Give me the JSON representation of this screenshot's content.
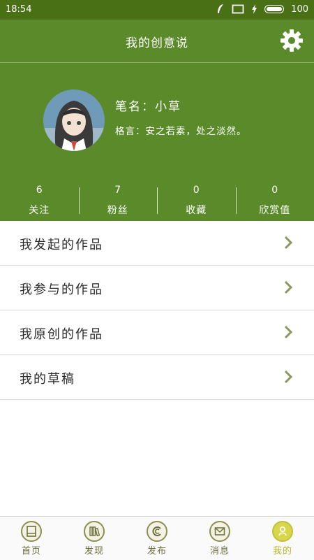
{
  "status_bar": {
    "time": "18:54",
    "battery": "100"
  },
  "header": {
    "title": "我的创意说"
  },
  "profile": {
    "pen_name": "笔名：小草",
    "motto": "格言：安之若素，处之淡然。"
  },
  "stats": [
    {
      "count": "6",
      "label": "关注"
    },
    {
      "count": "7",
      "label": "粉丝"
    },
    {
      "count": "0",
      "label": "收藏"
    },
    {
      "count": "0",
      "label": "欣赏值"
    }
  ],
  "menu": [
    {
      "label": "我发起的作品"
    },
    {
      "label": "我参与的作品"
    },
    {
      "label": "我原创的作品"
    },
    {
      "label": "我的草稿"
    }
  ],
  "tabs": [
    {
      "label": "首页",
      "icon": "home-icon"
    },
    {
      "label": "发现",
      "icon": "discover-icon"
    },
    {
      "label": "发布",
      "icon": "publish-icon"
    },
    {
      "label": "消息",
      "icon": "message-icon"
    },
    {
      "label": "我的",
      "icon": "profile-icon",
      "active": true
    }
  ],
  "colors": {
    "header_green": "#5a8a2a",
    "status_green": "#4a7016",
    "active_tab": "#d8d64a"
  }
}
